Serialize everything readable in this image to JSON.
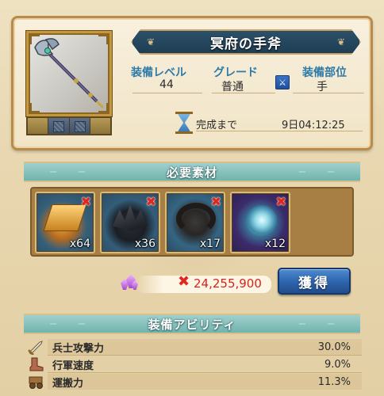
{
  "item": {
    "name": "冥府の手斧"
  },
  "stats": {
    "level_label": "装備レベル",
    "level_value": "44",
    "grade_label": "グレード",
    "grade_value": "普通",
    "slot_label": "装備部位",
    "slot_value": "手"
  },
  "timer": {
    "label": "完成まで",
    "value": "9日04:12:25"
  },
  "materials_section": {
    "title": "必要素材",
    "items": [
      {
        "name": "gold-ingots",
        "qty": "x64",
        "missing": true
      },
      {
        "name": "black-feathers",
        "qty": "x36",
        "missing": true
      },
      {
        "name": "horseshoe-horn",
        "qty": "x17",
        "missing": true
      },
      {
        "name": "spirit-orb",
        "qty": "x12",
        "missing": true
      }
    ]
  },
  "cost": {
    "value": "24,255,900",
    "button_label": "獲得"
  },
  "ability_section": {
    "title": "装備アビリティ",
    "rows": [
      {
        "name": "兵士攻撃力",
        "value": "30.0%",
        "icon": "sword-icon"
      },
      {
        "name": "行軍速度",
        "value": "9.0%",
        "icon": "boot-icon"
      },
      {
        "name": "運搬力",
        "value": "11.3%",
        "icon": "cart-icon"
      }
    ]
  },
  "colors": {
    "accent_blue": "#2d7aa8",
    "cost_red": "#d8221d",
    "banner_teal": "#71b3ae"
  }
}
